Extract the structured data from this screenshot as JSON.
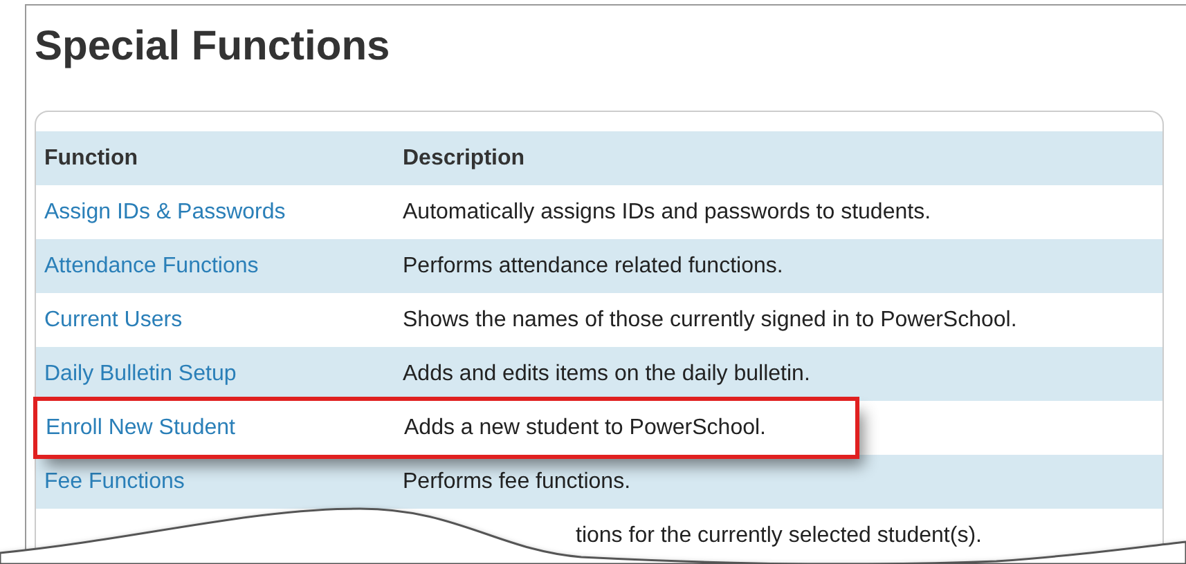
{
  "title": "Special Functions",
  "table": {
    "columns": [
      "Function",
      "Description"
    ],
    "rows": [
      {
        "function": "Assign IDs & Passwords",
        "description": "Automatically assigns IDs and passwords to students.",
        "highlighted": false
      },
      {
        "function": "Attendance Functions",
        "description": "Performs attendance related functions.",
        "highlighted": false
      },
      {
        "function": "Current Users",
        "description": "Shows the names of those currently signed in to PowerSchool.",
        "highlighted": false
      },
      {
        "function": "Daily Bulletin Setup",
        "description": "Adds and edits items on the daily bulletin.",
        "highlighted": false
      },
      {
        "function": "Enroll New Student",
        "description": "Adds a new student to PowerSchool.",
        "highlighted": true
      },
      {
        "function": "Fee Functions",
        "description": "Performs fee functions.",
        "highlighted": false
      }
    ],
    "cut_row": {
      "description": "tions for the currently selected student(s)."
    }
  }
}
